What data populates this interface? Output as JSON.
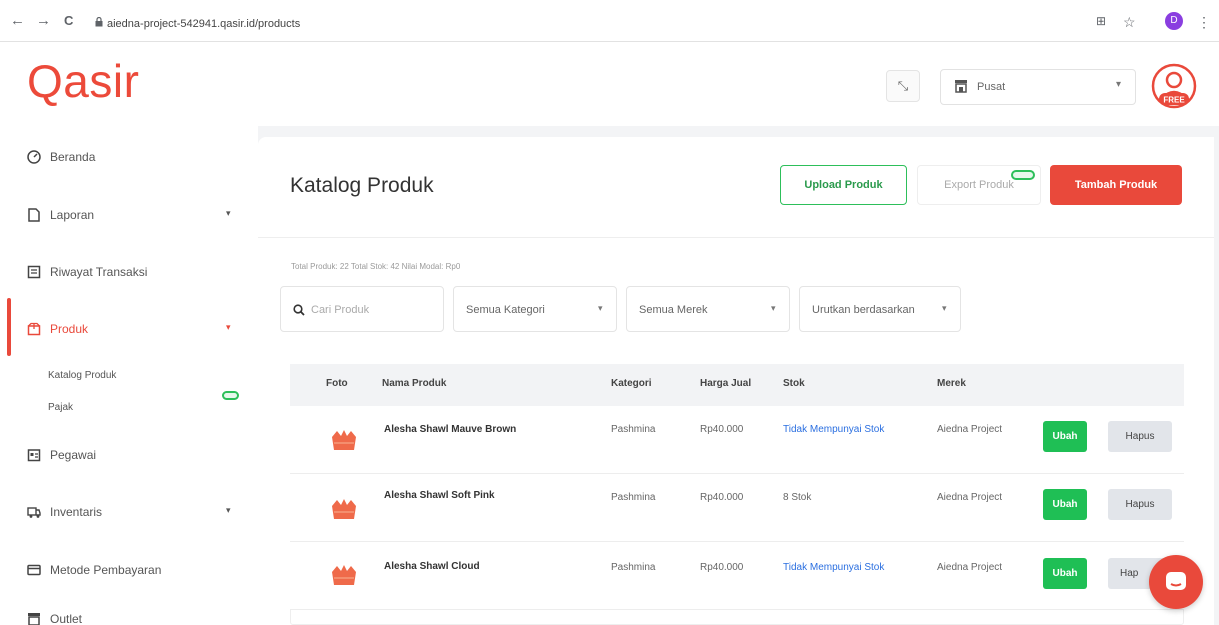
{
  "browser": {
    "url": "aiedna-project-542941.qasir.id/products",
    "back_glyph": "←",
    "forward_glyph": "→",
    "reload_glyph": "C",
    "star_glyph": "☆",
    "menu_glyph": "⋮",
    "translate_glyph": "⊞",
    "profile_initial": "D"
  },
  "header": {
    "logo": "Qasir",
    "expand_glyph": "⤡",
    "outlet_value": "Pusat",
    "caret": "▾",
    "avatar_badge": "FREE"
  },
  "sidebar": {
    "items": [
      {
        "label": "Beranda",
        "icon": "dashboard-icon"
      },
      {
        "label": "Laporan",
        "icon": "document-icon"
      },
      {
        "label": "Riwayat Transaksi",
        "icon": "receipt-icon"
      },
      {
        "label": "Produk",
        "icon": "box-icon"
      },
      {
        "label": "Pegawai",
        "icon": "id-card-icon"
      },
      {
        "label": "Inventaris",
        "icon": "truck-icon"
      },
      {
        "label": "Metode Pembayaran",
        "icon": "card-icon"
      },
      {
        "label": "Outlet",
        "icon": "store-icon"
      }
    ],
    "sub_items": [
      "Katalog Produk",
      "Pajak"
    ],
    "chevron": "▾"
  },
  "page": {
    "title": "Katalog Produk",
    "upload_label": "Upload Produk",
    "export_label": "Export Produk",
    "add_label": "Tambah Produk",
    "summary": "Total Produk: 22   Total Stok: 42   Nilai Modal: Rp0"
  },
  "filters": {
    "search_placeholder": "Cari Produk",
    "category": "Semua Kategori",
    "brand": "Semua Merek",
    "sort": "Urutkan berdasarkan",
    "caret": "▾"
  },
  "table": {
    "headers": [
      "Foto",
      "Nama Produk",
      "Kategori",
      "Harga Jual",
      "Stok",
      "Merek"
    ],
    "rows": [
      {
        "name": "Alesha Shawl Mauve Brown",
        "category": "Pashmina",
        "price": "Rp40.000",
        "stock": "Tidak Mempunyai Stok",
        "brand": "Aiedna Project"
      },
      {
        "name": "Alesha Shawl Soft Pink",
        "category": "Pashmina",
        "price": "Rp40.000",
        "stock": "8 Stok",
        "brand": "Aiedna Project"
      },
      {
        "name": "Alesha Shawl Cloud",
        "category": "Pashmina",
        "price": "Rp40.000",
        "stock": "Tidak Mempunyai Stok",
        "brand": "Aiedna Project"
      }
    ],
    "edit_label": "Ubah",
    "delete_label": "Hapus",
    "delete_label_cut": "Hap"
  },
  "colors": {
    "brand": "#e9493b",
    "success": "#1fbf55",
    "link": "#2b6fe0"
  }
}
